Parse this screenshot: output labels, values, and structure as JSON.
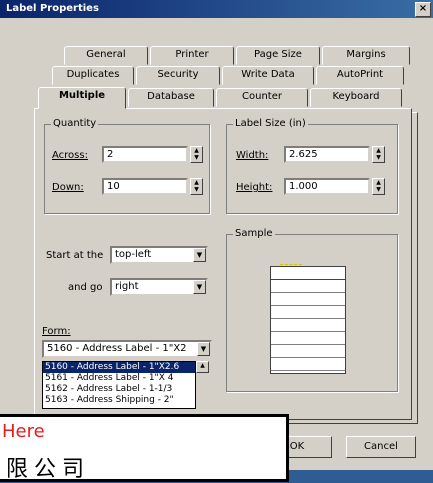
{
  "window": {
    "title": "Label Properties",
    "close_label": "×"
  },
  "tabs_row1": [
    "General",
    "Printer",
    "Page Size",
    "Margins"
  ],
  "tabs_row2": [
    "Duplicates",
    "Security",
    "Write Data",
    "AutoPrint"
  ],
  "tabs_row3": [
    "Multiple",
    "Database",
    "Counter",
    "Keyboard"
  ],
  "quantity": {
    "label": "Quantity",
    "across_label": "Across:",
    "across_value": "2",
    "down_label": "Down:",
    "down_value": "10"
  },
  "label_size": {
    "label": "Label Size (in)",
    "width_label": "Width:",
    "width_value": "2.625",
    "height_label": "Height:",
    "height_value": "1.000"
  },
  "start": {
    "label": "Start at the",
    "value": "top-left"
  },
  "go": {
    "label": "and go",
    "value": "right"
  },
  "form": {
    "label": "Form:",
    "value": "5160 - Address Label - 1\"X2",
    "options": [
      "5160 - Address Label - 1\"X2.6",
      "5161 - Address Label - 1\"X 4",
      "5162 - Address Label - 1-1/3",
      "5163 - Address Shipping - 2\""
    ]
  },
  "sample": {
    "label": "Sample",
    "rows": 8
  },
  "buttons": {
    "ok": "OK",
    "cancel": "Cancel"
  },
  "overlay": {
    "here_text": "Here",
    "chinese_text": "限公司"
  },
  "icons": {
    "spin": "spinner-arrows-icon",
    "dropdown": "dropdown-arrow-icon"
  }
}
